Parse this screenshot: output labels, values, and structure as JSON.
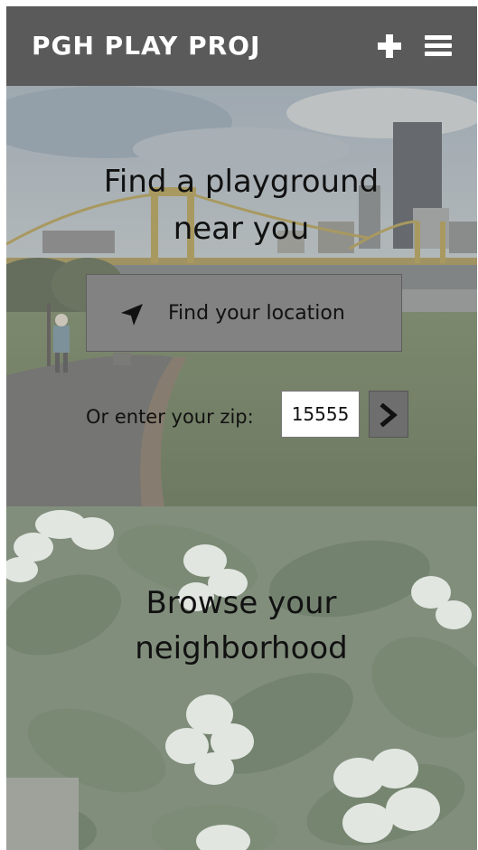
{
  "header": {
    "brand": "PGH PLAY PROJ",
    "add_icon": "plus-icon",
    "menu_icon": "hamburger-menu-icon",
    "background_color": "#5a5a5a"
  },
  "hero": {
    "title_line1": "Find a playground",
    "title_line2": "near you",
    "locate_button": {
      "icon": "location-arrow-icon",
      "label": "Find your location"
    },
    "zip": {
      "label": "Or enter your zip:",
      "value": "15555",
      "go_icon": "chevron-right-icon"
    }
  },
  "browse": {
    "title_line1": "Browse your",
    "title_line2": "neighborhood"
  }
}
